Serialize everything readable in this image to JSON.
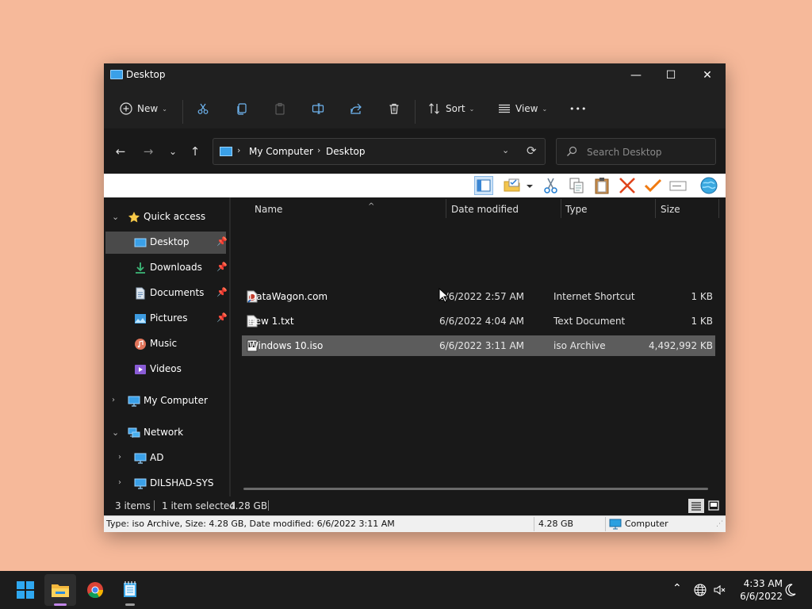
{
  "window": {
    "title": "Desktop",
    "controls": {
      "minimize": "—",
      "maximize": "☐",
      "close": "✕"
    }
  },
  "commandbar": {
    "new_label": "New",
    "sort_label": "Sort",
    "view_label": "View",
    "more_label": "•••"
  },
  "address": {
    "crumbs": [
      "My Computer",
      "Desktop"
    ],
    "separator": "›",
    "dropdown": "⌄",
    "refresh": "⟳"
  },
  "search": {
    "placeholder": "Search Desktop"
  },
  "nav": {
    "quick_access": "Quick access",
    "items": [
      {
        "label": "Desktop",
        "icon": "desktop-icon",
        "pinned": true
      },
      {
        "label": "Downloads",
        "icon": "download-icon",
        "pinned": true
      },
      {
        "label": "Documents",
        "icon": "documents-icon",
        "pinned": true
      },
      {
        "label": "Pictures",
        "icon": "pictures-icon",
        "pinned": true
      },
      {
        "label": "Music",
        "icon": "music-icon",
        "pinned": false
      },
      {
        "label": "Videos",
        "icon": "videos-icon",
        "pinned": false
      }
    ],
    "my_computer": "My Computer",
    "network": "Network",
    "network_items": [
      "AD",
      "DILSHAD-SYS"
    ]
  },
  "columns": {
    "name": "Name",
    "date": "Date modified",
    "type": "Type",
    "size": "Size"
  },
  "files": [
    {
      "name": "DataWagon.com",
      "date": "6/6/2022 2:57 AM",
      "type": "Internet Shortcut",
      "size": "1 KB",
      "icon": "internet-shortcut-icon"
    },
    {
      "name": "new 1.txt",
      "date": "6/6/2022 4:04 AM",
      "type": "Text Document",
      "size": "1 KB",
      "icon": "text-file-icon"
    },
    {
      "name": "Windows 10.iso",
      "date": "6/6/2022 3:11 AM",
      "type": "iso Archive",
      "size": "4,492,992 KB",
      "icon": "iso-file-icon"
    }
  ],
  "status": {
    "count": "3 items",
    "selection": "1 item selected",
    "size": "4.28 GB"
  },
  "legacy_status": {
    "info": "Type: iso Archive, Size: 4.28 GB, Date modified: 6/6/2022 3:11 AM",
    "size": "4.28 GB",
    "location": "Computer"
  },
  "clock": {
    "time": "4:33 AM",
    "date": "6/6/2022"
  },
  "colors": {
    "accent": "#3aa0e8",
    "window_bg": "#191919",
    "selection": "#5c5c5c",
    "desktop": "#f6b99a"
  }
}
